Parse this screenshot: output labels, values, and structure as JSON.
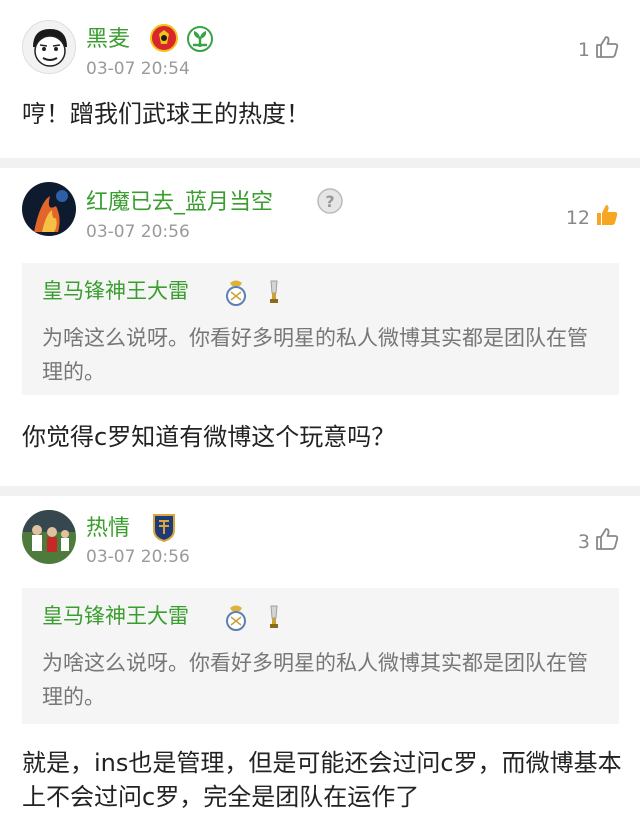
{
  "comments": [
    {
      "username": "黑麦",
      "timestamp": "03-07 20:54",
      "likes": "1",
      "liked": false,
      "text": "哼！蹭我们武球王的热度！",
      "badges": [
        "manchester-united-badge-icon",
        "green-plant-badge-icon"
      ]
    },
    {
      "username": "红魔已去_蓝月当空",
      "timestamp": "03-07 20:56",
      "likes": "12",
      "liked": true,
      "badges": [
        "question-mark-icon"
      ],
      "quote": {
        "username": "皇马锋神王大雷",
        "text": "为啥这么说呀。你看好多明星的私人微博其实都是团队在管理的。",
        "badges": [
          "real-madrid-badge-icon",
          "trophy-icon"
        ]
      },
      "text": "你觉得c罗知道有微博这个玩意吗？"
    },
    {
      "username": "热情",
      "timestamp": "03-07 20:56",
      "likes": "3",
      "liked": false,
      "badges": [
        "jiangsu-club-badge-icon"
      ],
      "quote": {
        "username": "皇马锋神王大雷",
        "text": "为啥这么说呀。你看好多明星的私人微博其实都是团队在管理的。",
        "badges": [
          "real-madrid-badge-icon",
          "trophy-icon"
        ]
      },
      "text": "就是，ins也是管理，但是可能还会过问c罗，而微博基本上不会过问c罗，完全是团队在运作了"
    }
  ],
  "colors": {
    "username": "#3a9e2f",
    "timestamp": "#9a9a9a",
    "like_active": "#f6a623",
    "divider": "#f1f1f1",
    "quote_bg": "#f5f5f5"
  }
}
